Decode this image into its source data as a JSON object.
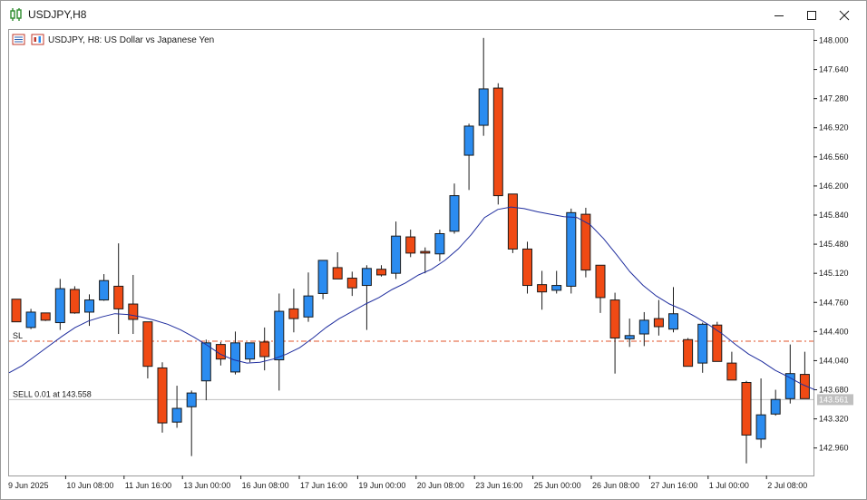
{
  "window": {
    "title": "USDJPY,H8",
    "controls": {
      "minimize_icon": "minimize-icon",
      "maximize_icon": "maximize-icon",
      "close_icon": "close-icon"
    }
  },
  "chart_header": {
    "symbol_text": "USDJPY, H8:  US Dollar vs Japanese Yen"
  },
  "colors": {
    "bull": "#2B8CF0",
    "bear": "#F04A14",
    "candle_outline": "#1a1a1a",
    "ma_line": "#1f2d9e",
    "sl_line": "#e0532a",
    "price_line": "#bfbfbf",
    "price_tag_bg": "#c0c0c0"
  },
  "chart_data": {
    "type": "candlestick",
    "symbol": "USDJPY",
    "timeframe": "H8",
    "ylim": [
      142.62,
      148.14
    ],
    "y_ticks": [
      "148.000",
      "147.640",
      "147.280",
      "146.920",
      "146.560",
      "146.200",
      "145.840",
      "145.480",
      "145.120",
      "144.760",
      "144.400",
      "144.040",
      "143.680",
      "143.320",
      "142.960"
    ],
    "x_ticks": [
      {
        "index": 0,
        "label": "9 Jun 2025"
      },
      {
        "index": 4,
        "label": "10 Jun 08:00"
      },
      {
        "index": 8,
        "label": "11 Jun 16:00"
      },
      {
        "index": 12,
        "label": "13 Jun 00:00"
      },
      {
        "index": 16,
        "label": "16 Jun 08:00"
      },
      {
        "index": 20,
        "label": "17 Jun 16:00"
      },
      {
        "index": 24,
        "label": "19 Jun 00:00"
      },
      {
        "index": 28,
        "label": "20 Jun 08:00"
      },
      {
        "index": 32,
        "label": "23 Jun 16:00"
      },
      {
        "index": 36,
        "label": "25 Jun 00:00"
      },
      {
        "index": 40,
        "label": "26 Jun 08:00"
      },
      {
        "index": 44,
        "label": "27 Jun 16:00"
      },
      {
        "index": 48,
        "label": "1 Jul 00:00"
      },
      {
        "index": 52,
        "label": "2 Jul 08:00"
      }
    ],
    "candles": [
      [
        144.8,
        144.79,
        144.52,
        144.52
      ],
      [
        144.45,
        144.68,
        144.43,
        144.64
      ],
      [
        144.63,
        144.63,
        144.53,
        144.54
      ],
      [
        144.51,
        145.05,
        144.42,
        144.93
      ],
      [
        144.92,
        144.96,
        144.62,
        144.63
      ],
      [
        144.64,
        144.86,
        144.47,
        144.79
      ],
      [
        144.79,
        145.11,
        144.78,
        145.03
      ],
      [
        144.96,
        145.49,
        144.37,
        144.68
      ],
      [
        144.74,
        145.1,
        144.37,
        144.55
      ],
      [
        144.52,
        144.52,
        143.82,
        143.97
      ],
      [
        143.95,
        144.02,
        143.15,
        143.27
      ],
      [
        143.28,
        143.73,
        143.21,
        143.45
      ],
      [
        143.47,
        143.67,
        142.86,
        143.64
      ],
      [
        143.79,
        144.3,
        143.55,
        144.26
      ],
      [
        144.24,
        144.27,
        143.98,
        144.06
      ],
      [
        143.9,
        144.4,
        143.87,
        144.26
      ],
      [
        144.06,
        144.2,
        144.02,
        144.26
      ],
      [
        144.27,
        144.45,
        143.92,
        144.09
      ],
      [
        144.05,
        144.87,
        143.67,
        144.65
      ],
      [
        144.68,
        144.93,
        144.39,
        144.56
      ],
      [
        144.58,
        145.13,
        144.52,
        144.84
      ],
      [
        144.87,
        145.27,
        144.8,
        145.28
      ],
      [
        145.19,
        145.38,
        145.05,
        145.05
      ],
      [
        145.06,
        145.14,
        144.84,
        144.94
      ],
      [
        144.97,
        145.22,
        144.42,
        145.18
      ],
      [
        145.17,
        145.22,
        145.08,
        145.1
      ],
      [
        145.12,
        145.76,
        145.05,
        145.58
      ],
      [
        145.57,
        145.66,
        145.32,
        145.37
      ],
      [
        145.39,
        145.44,
        145.12,
        145.37
      ],
      [
        145.36,
        145.66,
        145.27,
        145.61
      ],
      [
        145.64,
        146.23,
        145.61,
        146.08
      ],
      [
        146.58,
        146.97,
        146.15,
        146.94
      ],
      [
        146.95,
        148.03,
        146.82,
        147.4
      ],
      [
        147.41,
        147.47,
        145.97,
        146.08
      ],
      [
        146.1,
        146.1,
        145.37,
        145.42
      ],
      [
        145.42,
        145.51,
        144.87,
        144.97
      ],
      [
        144.98,
        145.15,
        144.67,
        144.89
      ],
      [
        144.91,
        145.15,
        144.87,
        144.97
      ],
      [
        144.96,
        145.92,
        144.87,
        145.87
      ],
      [
        145.85,
        145.93,
        145.07,
        145.16
      ],
      [
        145.22,
        145.19,
        144.63,
        144.82
      ],
      [
        144.79,
        144.88,
        143.88,
        144.32
      ],
      [
        144.31,
        144.56,
        144.21,
        144.35
      ],
      [
        144.37,
        144.64,
        144.22,
        144.54
      ],
      [
        144.56,
        144.79,
        144.35,
        144.46
      ],
      [
        144.43,
        144.95,
        144.39,
        144.62
      ],
      [
        144.3,
        144.32,
        143.97,
        143.97
      ],
      [
        144.01,
        144.51,
        143.89,
        144.49
      ],
      [
        144.48,
        144.52,
        144.03,
        144.03
      ],
      [
        144.01,
        144.15,
        143.84,
        143.8
      ],
      [
        143.77,
        143.79,
        142.77,
        143.12
      ],
      [
        143.07,
        143.82,
        142.96,
        143.37
      ],
      [
        143.38,
        143.68,
        143.36,
        143.56
      ],
      [
        143.57,
        144.24,
        143.51,
        143.88
      ],
      [
        143.87,
        144.15,
        143.57,
        143.57
      ]
    ],
    "moving_average": [
      143.89,
      143.98,
      144.1,
      144.22,
      144.34,
      144.45,
      144.53,
      144.58,
      144.62,
      144.61,
      144.58,
      144.54,
      144.49,
      144.42,
      144.33,
      144.23,
      144.12,
      144.05,
      144.01,
      144.02,
      144.06,
      144.12,
      144.2,
      144.32,
      144.45,
      144.56,
      144.65,
      144.74,
      144.82,
      144.92,
      145.0,
      145.1,
      145.17,
      145.28,
      145.42,
      145.6,
      145.81,
      145.91,
      145.94,
      145.92,
      145.88,
      145.85,
      145.82,
      145.81,
      145.72,
      145.55,
      145.35,
      145.14,
      144.97,
      144.84,
      144.74,
      144.67,
      144.58,
      144.48,
      144.37,
      144.24,
      144.12,
      144.03,
      143.92,
      143.84,
      143.75,
      143.68
    ],
    "levels": {
      "sl": {
        "price": 144.28,
        "label": "SL"
      },
      "sell": {
        "price": 143.558,
        "label": "SELL 0.01 at 143.558"
      },
      "current_price_tag": "143.561"
    }
  }
}
